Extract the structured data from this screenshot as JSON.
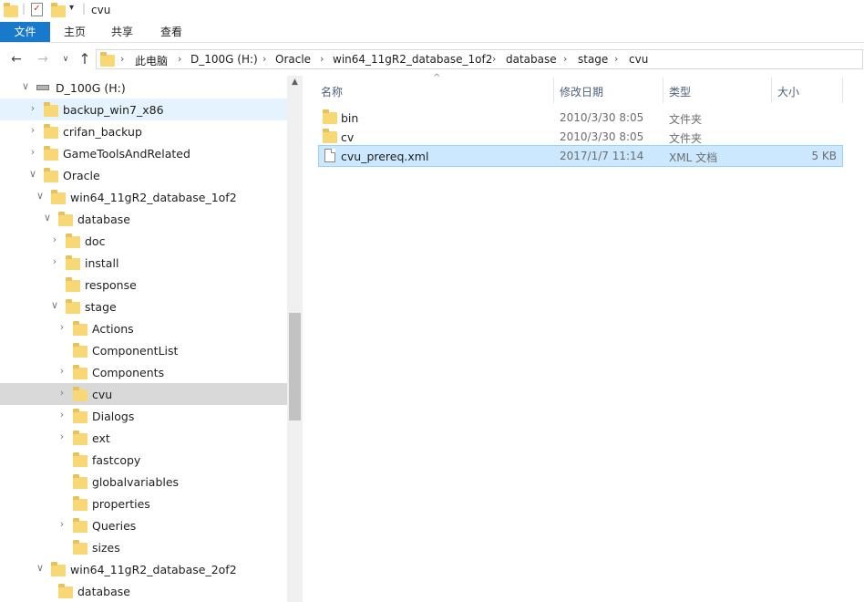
{
  "window": {
    "title": "cvu"
  },
  "ribbon": {
    "tabs": [
      "文件",
      "主页",
      "共享",
      "查看"
    ]
  },
  "breadcrumb": [
    "此电脑",
    "D_100G (H:)",
    "Oracle",
    "win64_11gR2_database_1of2",
    "database",
    "stage",
    "cvu"
  ],
  "tree": {
    "items": [
      {
        "label": "D_100G (H:)",
        "state": "expanded",
        "icon": "drive-icon",
        "selected": false,
        "hover": false
      },
      {
        "label": "backup_win7_x86",
        "state": "collapsed",
        "icon": "folder-icon",
        "selected": false,
        "hover": true
      },
      {
        "label": "crifan_backup",
        "state": "collapsed",
        "icon": "folder-icon",
        "selected": false,
        "hover": false
      },
      {
        "label": "GameToolsAndRelated",
        "state": "collapsed",
        "icon": "folder-icon",
        "selected": false,
        "hover": false
      },
      {
        "label": "Oracle",
        "state": "expanded",
        "icon": "folder-icon",
        "selected": false,
        "hover": false
      },
      {
        "label": "win64_11gR2_database_1of2",
        "state": "expanded",
        "icon": "folder-icon",
        "selected": false,
        "hover": false
      },
      {
        "label": "database",
        "state": "expanded",
        "icon": "folder-icon",
        "selected": false,
        "hover": false
      },
      {
        "label": "doc",
        "state": "collapsed",
        "icon": "folder-icon",
        "selected": false,
        "hover": false
      },
      {
        "label": "install",
        "state": "collapsed",
        "icon": "folder-icon",
        "selected": false,
        "hover": false
      },
      {
        "label": "response",
        "state": "none",
        "icon": "folder-icon",
        "selected": false,
        "hover": false
      },
      {
        "label": "stage",
        "state": "expanded",
        "icon": "folder-icon",
        "selected": false,
        "hover": false
      },
      {
        "label": "Actions",
        "state": "collapsed",
        "icon": "folder-icon",
        "selected": false,
        "hover": false
      },
      {
        "label": "ComponentList",
        "state": "none",
        "icon": "folder-icon",
        "selected": false,
        "hover": false
      },
      {
        "label": "Components",
        "state": "collapsed",
        "icon": "folder-icon",
        "selected": false,
        "hover": false
      },
      {
        "label": "cvu",
        "state": "collapsed",
        "icon": "folder-icon",
        "selected": true,
        "hover": false
      },
      {
        "label": "Dialogs",
        "state": "collapsed",
        "icon": "folder-icon",
        "selected": false,
        "hover": false
      },
      {
        "label": "ext",
        "state": "collapsed",
        "icon": "folder-icon",
        "selected": false,
        "hover": false
      },
      {
        "label": "fastcopy",
        "state": "none",
        "icon": "folder-icon",
        "selected": false,
        "hover": false
      },
      {
        "label": "globalvariables",
        "state": "none",
        "icon": "folder-icon",
        "selected": false,
        "hover": false
      },
      {
        "label": "properties",
        "state": "none",
        "icon": "folder-icon",
        "selected": false,
        "hover": false
      },
      {
        "label": "Queries",
        "state": "collapsed",
        "icon": "folder-icon",
        "selected": false,
        "hover": false
      },
      {
        "label": "sizes",
        "state": "none",
        "icon": "folder-icon",
        "selected": false,
        "hover": false
      },
      {
        "label": "win64_11gR2_database_2of2",
        "state": "expanded",
        "icon": "folder-icon",
        "selected": false,
        "hover": false
      },
      {
        "label": "database",
        "state": "none",
        "icon": "folder-icon",
        "selected": false,
        "hover": false
      }
    ]
  },
  "columns": {
    "name": "名称",
    "date": "修改日期",
    "type": "类型",
    "size": "大小"
  },
  "files": [
    {
      "name": "bin",
      "date": "2010/3/30 8:05",
      "type": "文件夹",
      "size": "",
      "kind": "folder",
      "selected": false
    },
    {
      "name": "cv",
      "date": "2010/3/30 8:05",
      "type": "文件夹",
      "size": "",
      "kind": "folder",
      "selected": false
    },
    {
      "name": "cvu_prereq.xml",
      "date": "2017/1/7 11:14",
      "type": "XML 文档",
      "size": "5 KB",
      "kind": "file",
      "selected": true
    }
  ],
  "colors": {
    "accent": "#1979ca",
    "selection": "#cce8ff",
    "selection_border": "#99d1ff",
    "tree_selected": "#d9d9d9",
    "tree_hover": "#e5f3ff"
  }
}
